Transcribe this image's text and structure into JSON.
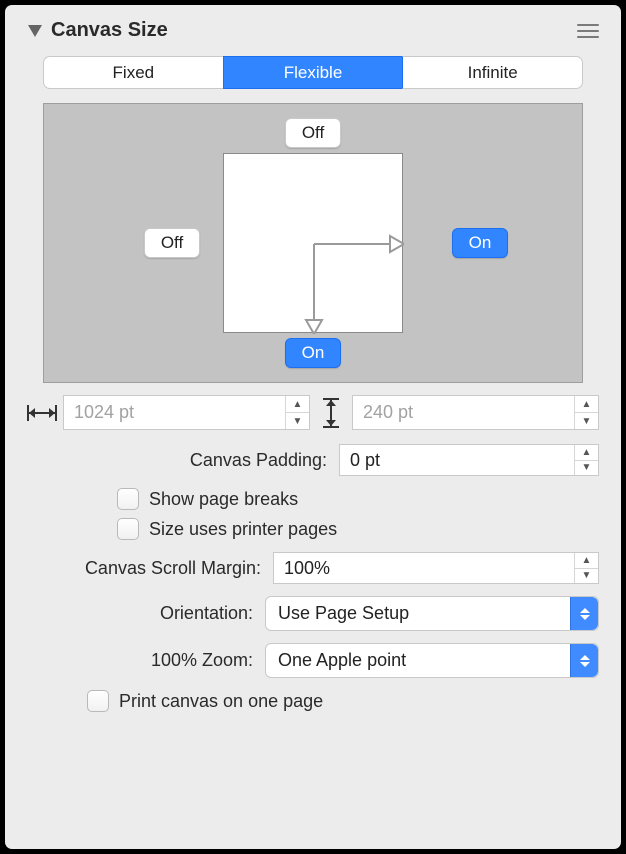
{
  "header": {
    "title": "Canvas Size"
  },
  "seg": {
    "fixed": "Fixed",
    "flexible": "Flexible",
    "infinite": "Infinite",
    "active": "flexible"
  },
  "preview": {
    "top": {
      "state": "off",
      "label": "Off"
    },
    "left": {
      "state": "off",
      "label": "Off"
    },
    "right": {
      "state": "on",
      "label": "On"
    },
    "bottom": {
      "state": "on",
      "label": "On"
    }
  },
  "dims": {
    "width": "1024 pt",
    "height": "240 pt"
  },
  "padding": {
    "label": "Canvas Padding:",
    "value": "0 pt"
  },
  "checks": {
    "page_breaks": "Show page breaks",
    "printer_pages": "Size uses printer pages",
    "print_one_page": "Print canvas on one page"
  },
  "scroll": {
    "label": "Canvas Scroll Margin:",
    "value": "100%"
  },
  "orientation": {
    "label": "Orientation:",
    "value": "Use Page Setup"
  },
  "zoom": {
    "label": "100% Zoom:",
    "value": "One Apple point"
  }
}
